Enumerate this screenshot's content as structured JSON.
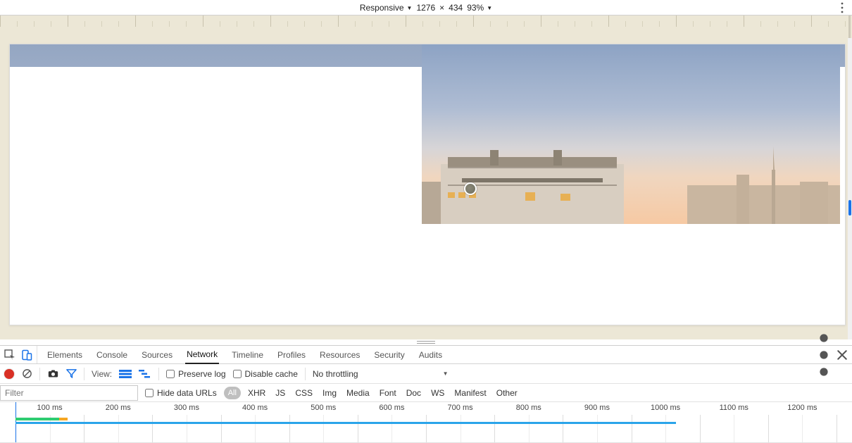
{
  "deviceBar": {
    "mode": "Responsive",
    "width": "1276",
    "height": "434",
    "zoom": "93%"
  },
  "devtools": {
    "tabs": [
      "Elements",
      "Console",
      "Sources",
      "Network",
      "Timeline",
      "Profiles",
      "Resources",
      "Security",
      "Audits"
    ],
    "activeTab": "Network",
    "toolbar": {
      "viewLabel": "View:",
      "preserveLog": "Preserve log",
      "disableCache": "Disable cache",
      "throttling": "No throttling"
    },
    "filter": {
      "placeholder": "Filter",
      "hideDataUrls": "Hide data URLs",
      "allPill": "All",
      "types": [
        "XHR",
        "JS",
        "CSS",
        "Img",
        "Media",
        "Font",
        "Doc",
        "WS",
        "Manifest",
        "Other"
      ]
    },
    "timeline": {
      "ticks": [
        "100 ms",
        "200 ms",
        "300 ms",
        "400 ms",
        "500 ms",
        "600 ms",
        "700 ms",
        "800 ms",
        "900 ms",
        "1000 ms",
        "1100 ms",
        "1200 ms"
      ],
      "blueBarEndPx": 960
    }
  }
}
